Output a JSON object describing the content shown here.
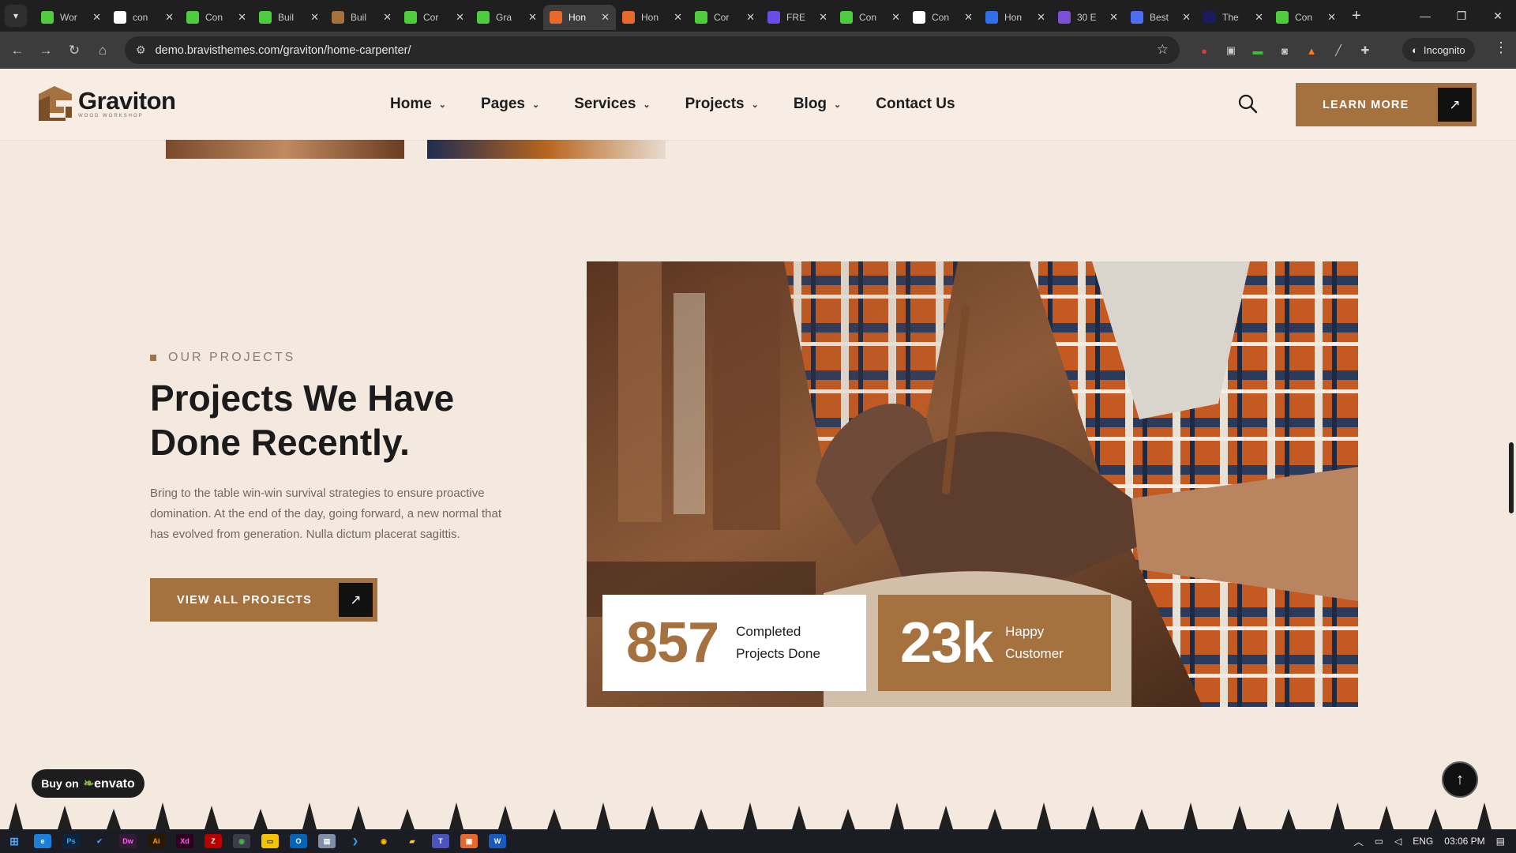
{
  "browser": {
    "tabs": [
      {
        "label": "Wor",
        "icon": "elementor-icon",
        "color": "#4ecc3e"
      },
      {
        "label": "con",
        "icon": "google-icon",
        "color": "#ffffff"
      },
      {
        "label": "Con",
        "icon": "elementor-icon",
        "color": "#4ecc3e"
      },
      {
        "label": "Buil",
        "icon": "elementor-icon",
        "color": "#4ecc3e"
      },
      {
        "label": "Buil",
        "icon": "building-icon",
        "color": "#a5713f"
      },
      {
        "label": "Cor",
        "icon": "elementor-icon",
        "color": "#4ecc3e"
      },
      {
        "label": "Gra",
        "icon": "elementor-icon",
        "color": "#4ecc3e"
      },
      {
        "label": "Hon",
        "icon": "graviton-icon",
        "color": "#e8692b",
        "active": true
      },
      {
        "label": "Hon",
        "icon": "graviton-icon",
        "color": "#e8692b"
      },
      {
        "label": "Cor",
        "icon": "elementor-icon",
        "color": "#4ecc3e"
      },
      {
        "label": "FRE",
        "icon": "astra-icon",
        "color": "#6b4ce6"
      },
      {
        "label": "Con",
        "icon": "elementor-icon",
        "color": "#4ecc3e"
      },
      {
        "label": "Con",
        "icon": "wix-icon",
        "color": "#ffffff"
      },
      {
        "label": "Hon",
        "icon": "wordpress-icon",
        "color": "#2f6fe8"
      },
      {
        "label": "30 E",
        "icon": "envato-icon",
        "color": "#7b4fd6"
      },
      {
        "label": "Best",
        "icon": "diamond-icon",
        "color": "#4c6ef5"
      },
      {
        "label": "The",
        "icon": "yoast-icon",
        "color": "#1b1b5e"
      },
      {
        "label": "Con",
        "icon": "elementor-icon",
        "color": "#4ecc3e"
      }
    ],
    "url": "demo.bravisthemes.com/graviton/home-carpenter/",
    "incognito_label": "Incognito"
  },
  "header": {
    "logo_name": "Graviton",
    "logo_tagline": "WOOD WORKSHOP",
    "nav": [
      {
        "label": "Home",
        "has_dropdown": true
      },
      {
        "label": "Pages",
        "has_dropdown": true
      },
      {
        "label": "Services",
        "has_dropdown": true
      },
      {
        "label": "Projects",
        "has_dropdown": true
      },
      {
        "label": "Blog",
        "has_dropdown": true
      },
      {
        "label": "Contact Us",
        "has_dropdown": false
      }
    ],
    "cta_label": "LEARN MORE",
    "accent_color": "#a5713f"
  },
  "projects_section": {
    "eyebrow": "OUR PROJECTS",
    "heading_line1": "Projects We Have",
    "heading_line2": "Done Recently.",
    "description": "Bring to the table win-win survival strategies to ensure proactive domination. At the end of the day, going forward, a new normal that has evolved from generation. Nulla dictum placerat sagittis.",
    "button_label": "VIEW ALL PROJECTS",
    "stats": [
      {
        "number": "857",
        "label_line1": "Completed",
        "label_line2": "Projects Done"
      },
      {
        "number": "23k",
        "label_line1": "Happy",
        "label_line2": "Customer"
      }
    ]
  },
  "floating": {
    "envato_prefix": "Buy on",
    "envato_brand": "envato"
  },
  "taskbar": {
    "language": "ENG",
    "time": "03:06 PM"
  }
}
